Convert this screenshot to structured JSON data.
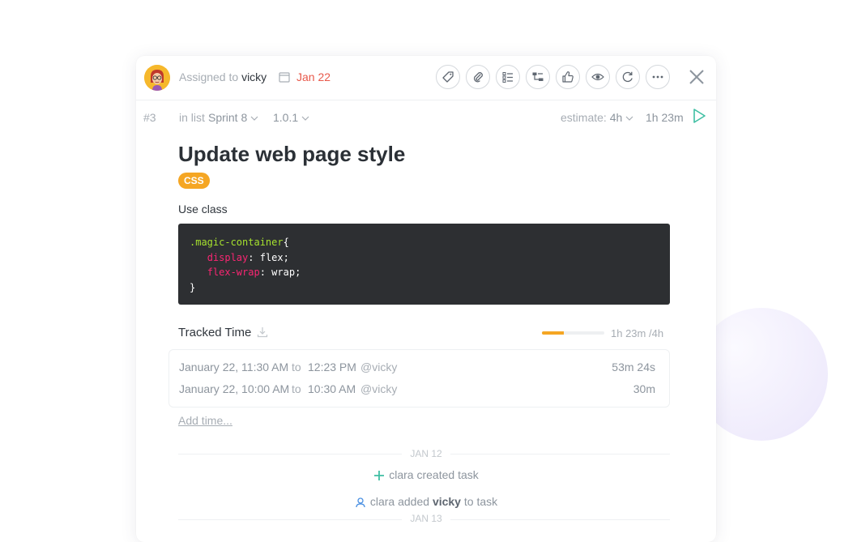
{
  "header": {
    "avatar_icon": "user-avatar-icon",
    "assigned_prefix": "Assigned to",
    "assignee": "vicky",
    "due_date": "Jan 22",
    "due_color": "#e8594b",
    "toolbar_icons": [
      "tag-icon",
      "attachment-icon",
      "checklist-icon",
      "subtask-icon",
      "thumbs-up-icon",
      "eye-icon",
      "repeat-icon",
      "more-icon"
    ],
    "close_icon": "close-icon"
  },
  "meta": {
    "task_number": "#3",
    "list_prefix": "in list",
    "list_name": "Sprint 8",
    "version": "1.0.1",
    "estimate_label": "estimate:",
    "estimate_value": "4h",
    "tracked_total": "1h 23m"
  },
  "task": {
    "title": "Update web page style",
    "tag": "CSS",
    "tag_color": "#f5a623",
    "description": "Use class",
    "code": {
      "selector": ".magic-container",
      "open": "{",
      "lines": [
        {
          "prop": "display",
          "value": "flex;"
        },
        {
          "prop": "flex-wrap",
          "value": "wrap;"
        }
      ],
      "close": "}"
    }
  },
  "tracked_time": {
    "heading": "Tracked Time",
    "progress_fraction": 0.35,
    "total_label": "1h 23m /4h",
    "to_word": "to",
    "entries": [
      {
        "from": "January 22, 11:30 AM",
        "to": "12:23 PM",
        "user": "@vicky",
        "duration": "53m 24s"
      },
      {
        "from": "January 22, 10:00 AM",
        "to": "10:30 AM",
        "user": "@vicky",
        "duration": "30m"
      }
    ],
    "add_time": "Add time..."
  },
  "activity": {
    "day1": "JAN 12",
    "event1": "clara created task",
    "event2_user": "clara added",
    "event2_target": "vicky",
    "event2_suffix": "to task",
    "day2": "JAN 13"
  }
}
